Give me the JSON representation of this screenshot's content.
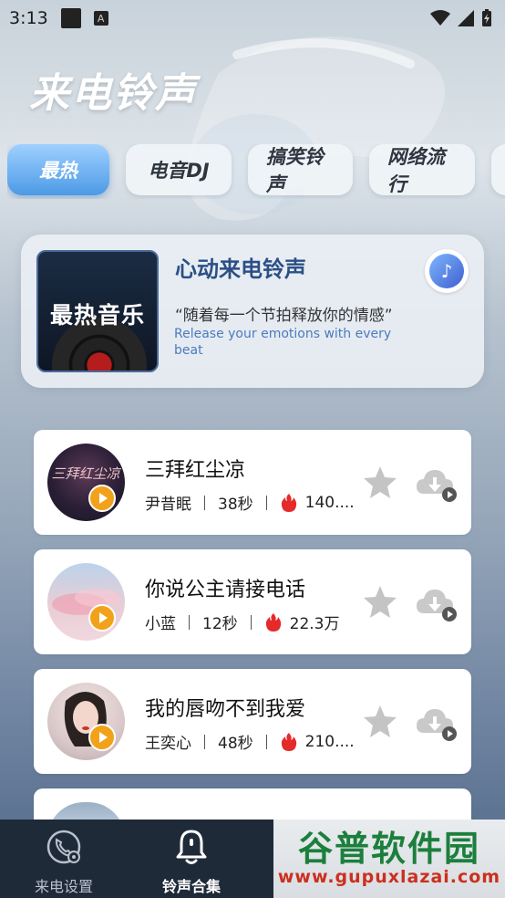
{
  "status_bar": {
    "time": "3:13"
  },
  "app": {
    "title": "来电铃声"
  },
  "tabs": [
    {
      "label": "最热",
      "active": true
    },
    {
      "label": "电音DJ",
      "active": false
    },
    {
      "label": "搞笑铃声",
      "active": false
    },
    {
      "label": "网络流行",
      "active": false
    }
  ],
  "featured": {
    "cover_text": "最热音乐",
    "title": "心动来电铃声",
    "quote": "“随着每一个节拍释放你的情感”",
    "subtitle_en": "Release your emotions with every beat",
    "badge_icon": "music-note-icon"
  },
  "songs": [
    {
      "title": "三拜红尘凉",
      "artist": "尹昔眠",
      "duration": "38秒",
      "heat": "140...."
    },
    {
      "title": "你说公主请接电话",
      "artist": "小蓝",
      "duration": "12秒",
      "heat": "22.3万"
    },
    {
      "title": "我的唇吻不到我爱",
      "artist": "王奕心",
      "duration": "48秒",
      "heat": "210...."
    }
  ],
  "bottom_nav": {
    "items": [
      {
        "label": "来电设置",
        "icon": "phone-settings-icon",
        "active": false
      },
      {
        "label": "铃声合集",
        "icon": "bell-icon",
        "active": true
      }
    ]
  },
  "watermark": {
    "cn": "谷普软件园",
    "url": "www.gupuxlazai.com"
  },
  "colors": {
    "accent": "#4c9ae6",
    "fire": "#e52a2a",
    "play": "#f2a21a",
    "nav_bg": "#1f2a39"
  }
}
